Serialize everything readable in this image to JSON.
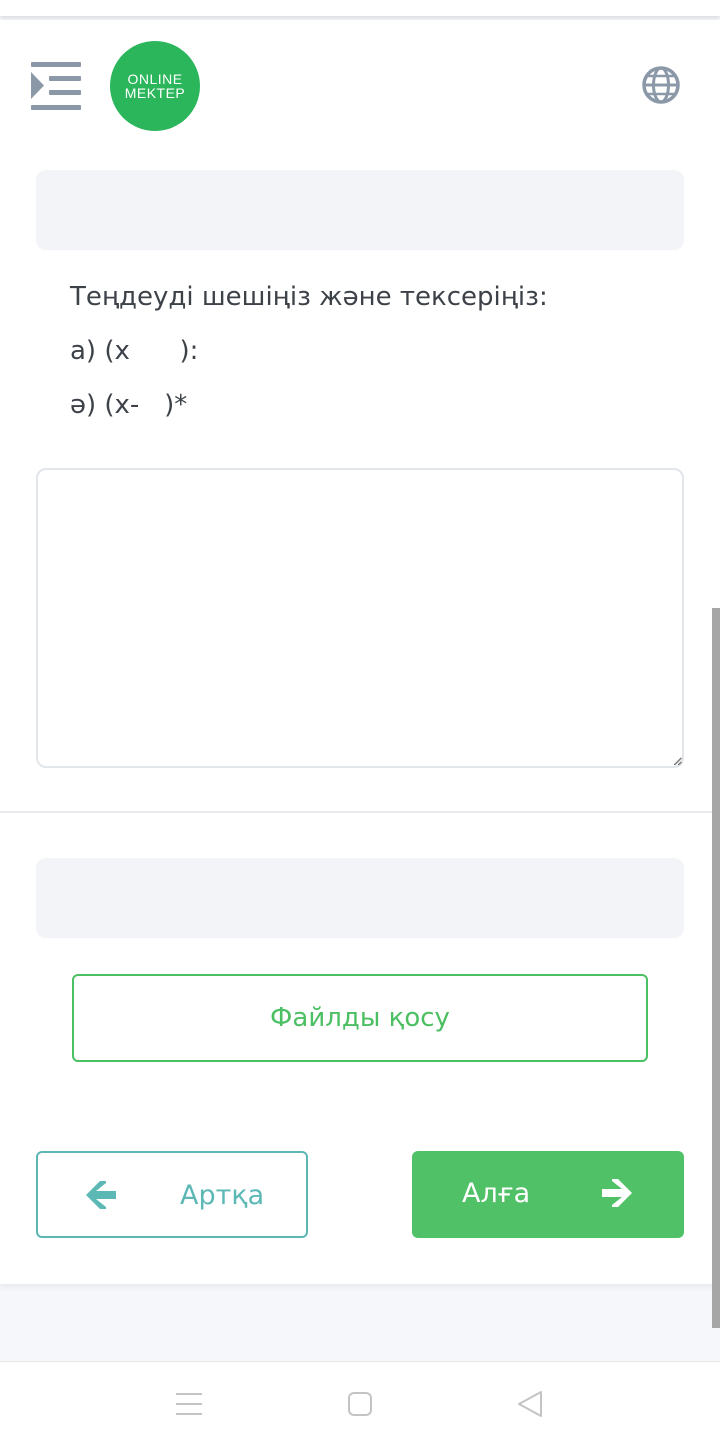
{
  "header": {
    "logo_line1": "ONLINE",
    "logo_line2": "MEKTEP"
  },
  "question": {
    "prompt": "Теңдеуді шешіңіз және тексеріңіз:",
    "item_a": "а) (х      ):",
    "item_b": "ә) (х-   )*"
  },
  "actions": {
    "attach_file_label": "Файлды қосу",
    "back_label": "Артқа",
    "next_label": "Алға"
  },
  "colors": {
    "brand_green": "#2bb65b",
    "button_green": "#50c167",
    "teal": "#5bb8b5",
    "icon_gray": "#8a98a8"
  },
  "icons": {
    "menu": "indent-menu-icon",
    "globe": "globe-icon",
    "back_arrow": "arrow-left-icon",
    "next_arrow": "arrow-right-icon",
    "nav_recents": "recents-icon",
    "nav_home": "home-icon",
    "nav_back": "nav-back-icon"
  }
}
